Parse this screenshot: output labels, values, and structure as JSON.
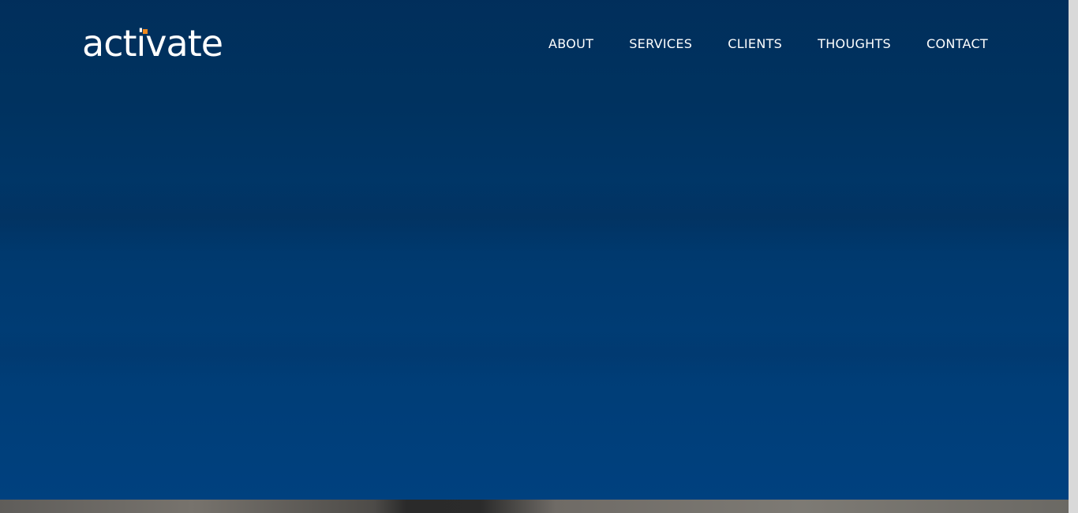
{
  "brand": {
    "logo_text": "activate",
    "accent_color": "#f28a1d"
  },
  "nav": {
    "items": [
      {
        "label": "ABOUT"
      },
      {
        "label": "SERVICES"
      },
      {
        "label": "CLIENTS"
      },
      {
        "label": "THOUGHTS"
      },
      {
        "label": "CONTACT"
      }
    ]
  },
  "colors": {
    "hero_top": "#013261",
    "hero_bottom": "#00417f",
    "nav_text": "#ffffff"
  }
}
